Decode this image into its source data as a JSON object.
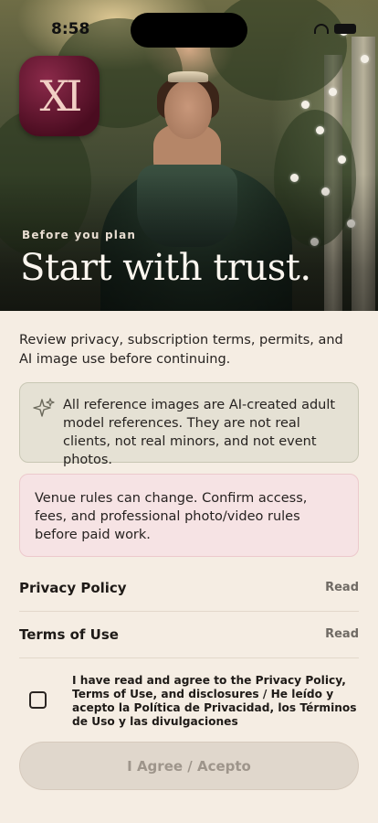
{
  "status_bar": {
    "time": "8:58"
  },
  "app": {
    "logo_text": "XI"
  },
  "hero": {
    "kicker": "Before you plan",
    "title": "Start with trust."
  },
  "intro": "Review privacy, subscription terms, permits, and AI image use before continuing.",
  "notices": {
    "ai_images": "All reference images are AI-created adult model references. They are not real clients, not real minors, and not event photos.",
    "venue": "Venue rules can change. Confirm access, fees, and professional photo/video rules before paid work."
  },
  "documents": [
    {
      "label": "Privacy Policy",
      "action": "Read"
    },
    {
      "label": "Terms of Use",
      "action": "Read"
    }
  ],
  "agreement": {
    "checked": false,
    "text": "I have read and agree to the Privacy Policy, Terms of Use, and disclosures / He leído y acepto la Política de Privacidad, los Términos de Uso y las divulgaciones"
  },
  "cta": {
    "label": "I Agree / Acepto",
    "enabled": false
  },
  "colors": {
    "background": "#f5ede3",
    "ai_card": "#e5e1d4",
    "venue_card": "#f6e3e4",
    "logo": "#6a1733",
    "cta_disabled": "#e0d7cc"
  }
}
